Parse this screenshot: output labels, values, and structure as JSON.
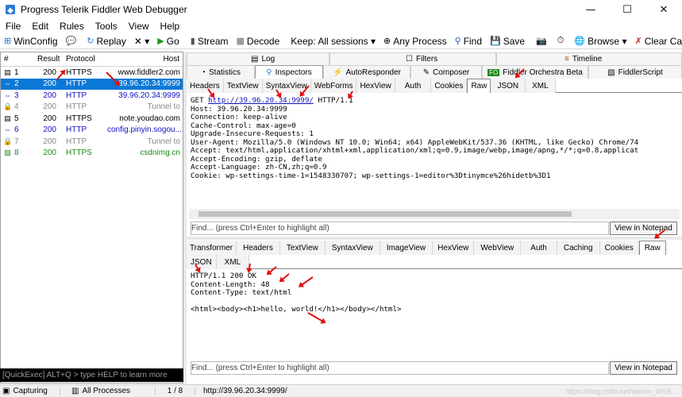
{
  "window": {
    "title": "Progress Telerik Fiddler Web Debugger",
    "minimize": "—",
    "maximize": "☐",
    "close": "✕"
  },
  "menu": [
    "File",
    "Edit",
    "Rules",
    "Tools",
    "View",
    "Help"
  ],
  "toolbar": {
    "winconfig": "WinConfig",
    "replay": "Replay",
    "remove": "✕ ▾",
    "go": "Go",
    "stream": "Stream",
    "decode": "Decode",
    "keep": "Keep: All sessions ▾",
    "any_process": "Any Process",
    "find": "Find",
    "save": "Save",
    "browse": "Browse ▾",
    "clear_cache": "Clear Cache"
  },
  "sessions": {
    "headers": [
      "#",
      "Result",
      "Protocol",
      "Host"
    ],
    "rows": [
      {
        "id": "1",
        "result": "200",
        "protocol": "HTTPS",
        "host": "www.fiddler2.com",
        "color": "#000000",
        "icon": "doc-icon"
      },
      {
        "id": "2",
        "result": "200",
        "protocol": "HTTP",
        "host": "39.96.20.34:9999",
        "color": "#ffffff",
        "icon": "arrows-icon",
        "selected": true
      },
      {
        "id": "3",
        "result": "200",
        "protocol": "HTTP",
        "host": "39.96.20.34:9999",
        "color": "#1010c0",
        "icon": "arrows-icon"
      },
      {
        "id": "4",
        "result": "200",
        "protocol": "HTTP",
        "host": "Tunnel to",
        "color": "#888888",
        "icon": "lock-icon"
      },
      {
        "id": "5",
        "result": "200",
        "protocol": "HTTPS",
        "host": "note.youdao.com",
        "color": "#000000",
        "icon": "doc-icon"
      },
      {
        "id": "6",
        "result": "200",
        "protocol": "HTTP",
        "host": "config.pinyin.sogou....",
        "color": "#1010c0",
        "icon": "arrows-icon"
      },
      {
        "id": "7",
        "result": "200",
        "protocol": "HTTP",
        "host": "Tunnel to",
        "color": "#888888",
        "icon": "lock-icon"
      },
      {
        "id": "8",
        "result": "200",
        "protocol": "HTTPS",
        "host": "csdnimg.cn",
        "color": "#1a8a1a",
        "icon": "image-icon"
      }
    ]
  },
  "quickexec": "[QuickExec] ALT+Q > type HELP to learn more",
  "status": {
    "capturing": "Capturing",
    "processes": "All Processes",
    "count": "1 / 8",
    "url": "http://39.96.20.34:9999/",
    "watermark": "https://blog.csdn.net/weixin_4016..."
  },
  "top_tabs": {
    "log": "Log",
    "filters": "Filters",
    "timeline": "Timeline"
  },
  "main_tabs": [
    "Statistics",
    "Inspectors",
    "AutoResponder",
    "Composer",
    "Fiddler Orchestra Beta",
    "FiddlerScript"
  ],
  "request_tabs": [
    "Headers",
    "TextView",
    "SyntaxView",
    "WebForms",
    "HexView",
    "Auth",
    "Cookies",
    "Raw",
    "JSON",
    "XML"
  ],
  "request_raw": {
    "line1_pre": "GET ",
    "line1_url": "http://39.96.20.34:9999/",
    "line1_post": " HTTP/1.1",
    "lines": "Host: 39.96.20.34:9999\nConnection: keep-alive\nCache-Control: max-age=0\nUpgrade-Insecure-Requests: 1\nUser-Agent: Mozilla/5.0 (Windows NT 10.0; Win64; x64) AppleWebKit/537.36 (KHTML, like Gecko) Chrome/74\nAccept: text/html,application/xhtml+xml,application/xml;q=0.9,image/webp,image/apng,*/*;q=0.8,applicat\nAccept-Encoding: gzip, deflate\nAccept-Language: zh-CN,zh;q=0.9\nCookie: wp-settings-time-1=1548330707; wp-settings-1=editor%3Dtinymce%26hidetb%3D1"
  },
  "find_placeholder": "Find... (press Ctrl+Enter to highlight all)",
  "view_in_notepad": "View in Notepad",
  "response_tabs": [
    "Transformer",
    "Headers",
    "TextView",
    "SyntaxView",
    "ImageView",
    "HexView",
    "WebView",
    "Auth",
    "Caching",
    "Cookies",
    "Raw"
  ],
  "response_tabs2": [
    "JSON",
    "XML"
  ],
  "response_raw": "HTTP/1.1 200 OK\nContent-Length: 48\nContent-Type: text/html\n\n<html><body><h1>hello, world!</h1></body></html>"
}
